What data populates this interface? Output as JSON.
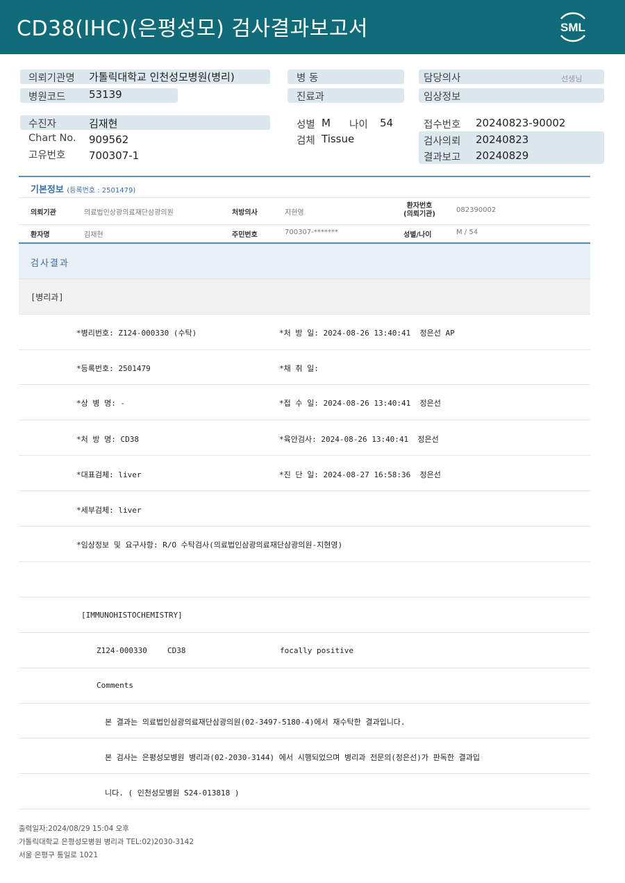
{
  "header": {
    "title": "CD38(IHC)(은평성모) 검사결과보고서",
    "logo_text": "SML",
    "bg_color": "#0f6b77"
  },
  "summary": {
    "requesting_institution_label": "의뢰기관명",
    "requesting_institution_value": "가톨릭대학교 인천성모병원(병리)",
    "hospital_code_label": "병원코드",
    "hospital_code_value": "53139",
    "ward_label": "병 동",
    "department_label": "진료과",
    "doctor_label": "담당의사",
    "doctor_suffix": "선생님",
    "clinical_info_label": "임상정보",
    "patient_label": "수진자",
    "patient_value": "김재현",
    "chart_label": "Chart No.",
    "chart_value": "909562",
    "unique_id_label": "고유번호",
    "unique_id_value": "700307-1",
    "sex_label": "성별",
    "sex_value": "M",
    "age_label": "나이",
    "age_value": "54",
    "specimen_label": "검체",
    "specimen_value": "Tissue",
    "receipt_no_label": "접수번호",
    "receipt_no_value": "20240823-90002",
    "requested_label": "검사의뢰",
    "requested_value": "20240823",
    "reported_label": "결과보고",
    "reported_value": "20240829"
  },
  "basic_info": {
    "title": "기본정보",
    "reg_no": "(등록번호 : 2501479)",
    "row1": {
      "inst_label": "의뢰기관",
      "inst_value": "의료법인상광의료재단삼광의원",
      "prescriber_label": "처방의사",
      "prescriber_value": "지현영",
      "patient_no_label": "환자번호",
      "patient_no_label2": "(의뢰기관)",
      "patient_no_value": "082390002"
    },
    "row2": {
      "name_label": "환자명",
      "name_value": "김재현",
      "rrn_label": "주민번호",
      "rrn_value": "700307-*******",
      "sexage_label": "성별/나이",
      "sexage_value": "M / 54"
    }
  },
  "results": {
    "title": "검사결과",
    "dept": "[병리과]",
    "pathology_no": "*병리번호: Z124-000330 (수탁)",
    "order_date": "*처 방 일: 2024-08-26 13:40:41  정은선 AP",
    "reg_no": "*등록번호: 2501479",
    "collect_date": "*채 취 일:",
    "disease_name": "*상 병 명: -",
    "receive_date": "*접 수 일: 2024-08-26 13:40:41  정은선",
    "order_name": "*처 방 명: CD38",
    "gross_exam": "*육안검사: 2024-08-26 13:40:41  정은선",
    "main_specimen": "*대표검체: liver",
    "diag_date": "*진 단 일: 2024-08-27 16:58:36  정은선",
    "sub_specimen": "*세부검체: liver",
    "clinical_req": "*임상정보 및 요구사항: R/O 수탁검사(의료법인삼광의료재단삼광의원-지현영)",
    "ihc_header": "[IMMUNOHISTOCHEMISTRY]",
    "ihc_id": "Z124-000330",
    "ihc_marker": "CD38",
    "ihc_result": "focally positive",
    "comments_label": "Comments",
    "comment1": "본 결과는 의료법인삼광의료재단삼광의원(02-3497-5180-4)에서 재수탁한 결과입니다.",
    "comment2": "본 검사는 은평성모병원 병리과(02-2030-3144) 에서 시행되었으며 병리과 전문의(정은선)가 판독한 결과입",
    "comment3": "니다. ( 인천성모병원 S24-013818 )"
  },
  "footer": {
    "print_date": "출력일자:2024/08/29 15:04 오후",
    "hospital": "가톨릭대학교 은평성모병원 병리과 TEL:02)2030-3142",
    "address": "서울 은평구 통일로 1021"
  }
}
